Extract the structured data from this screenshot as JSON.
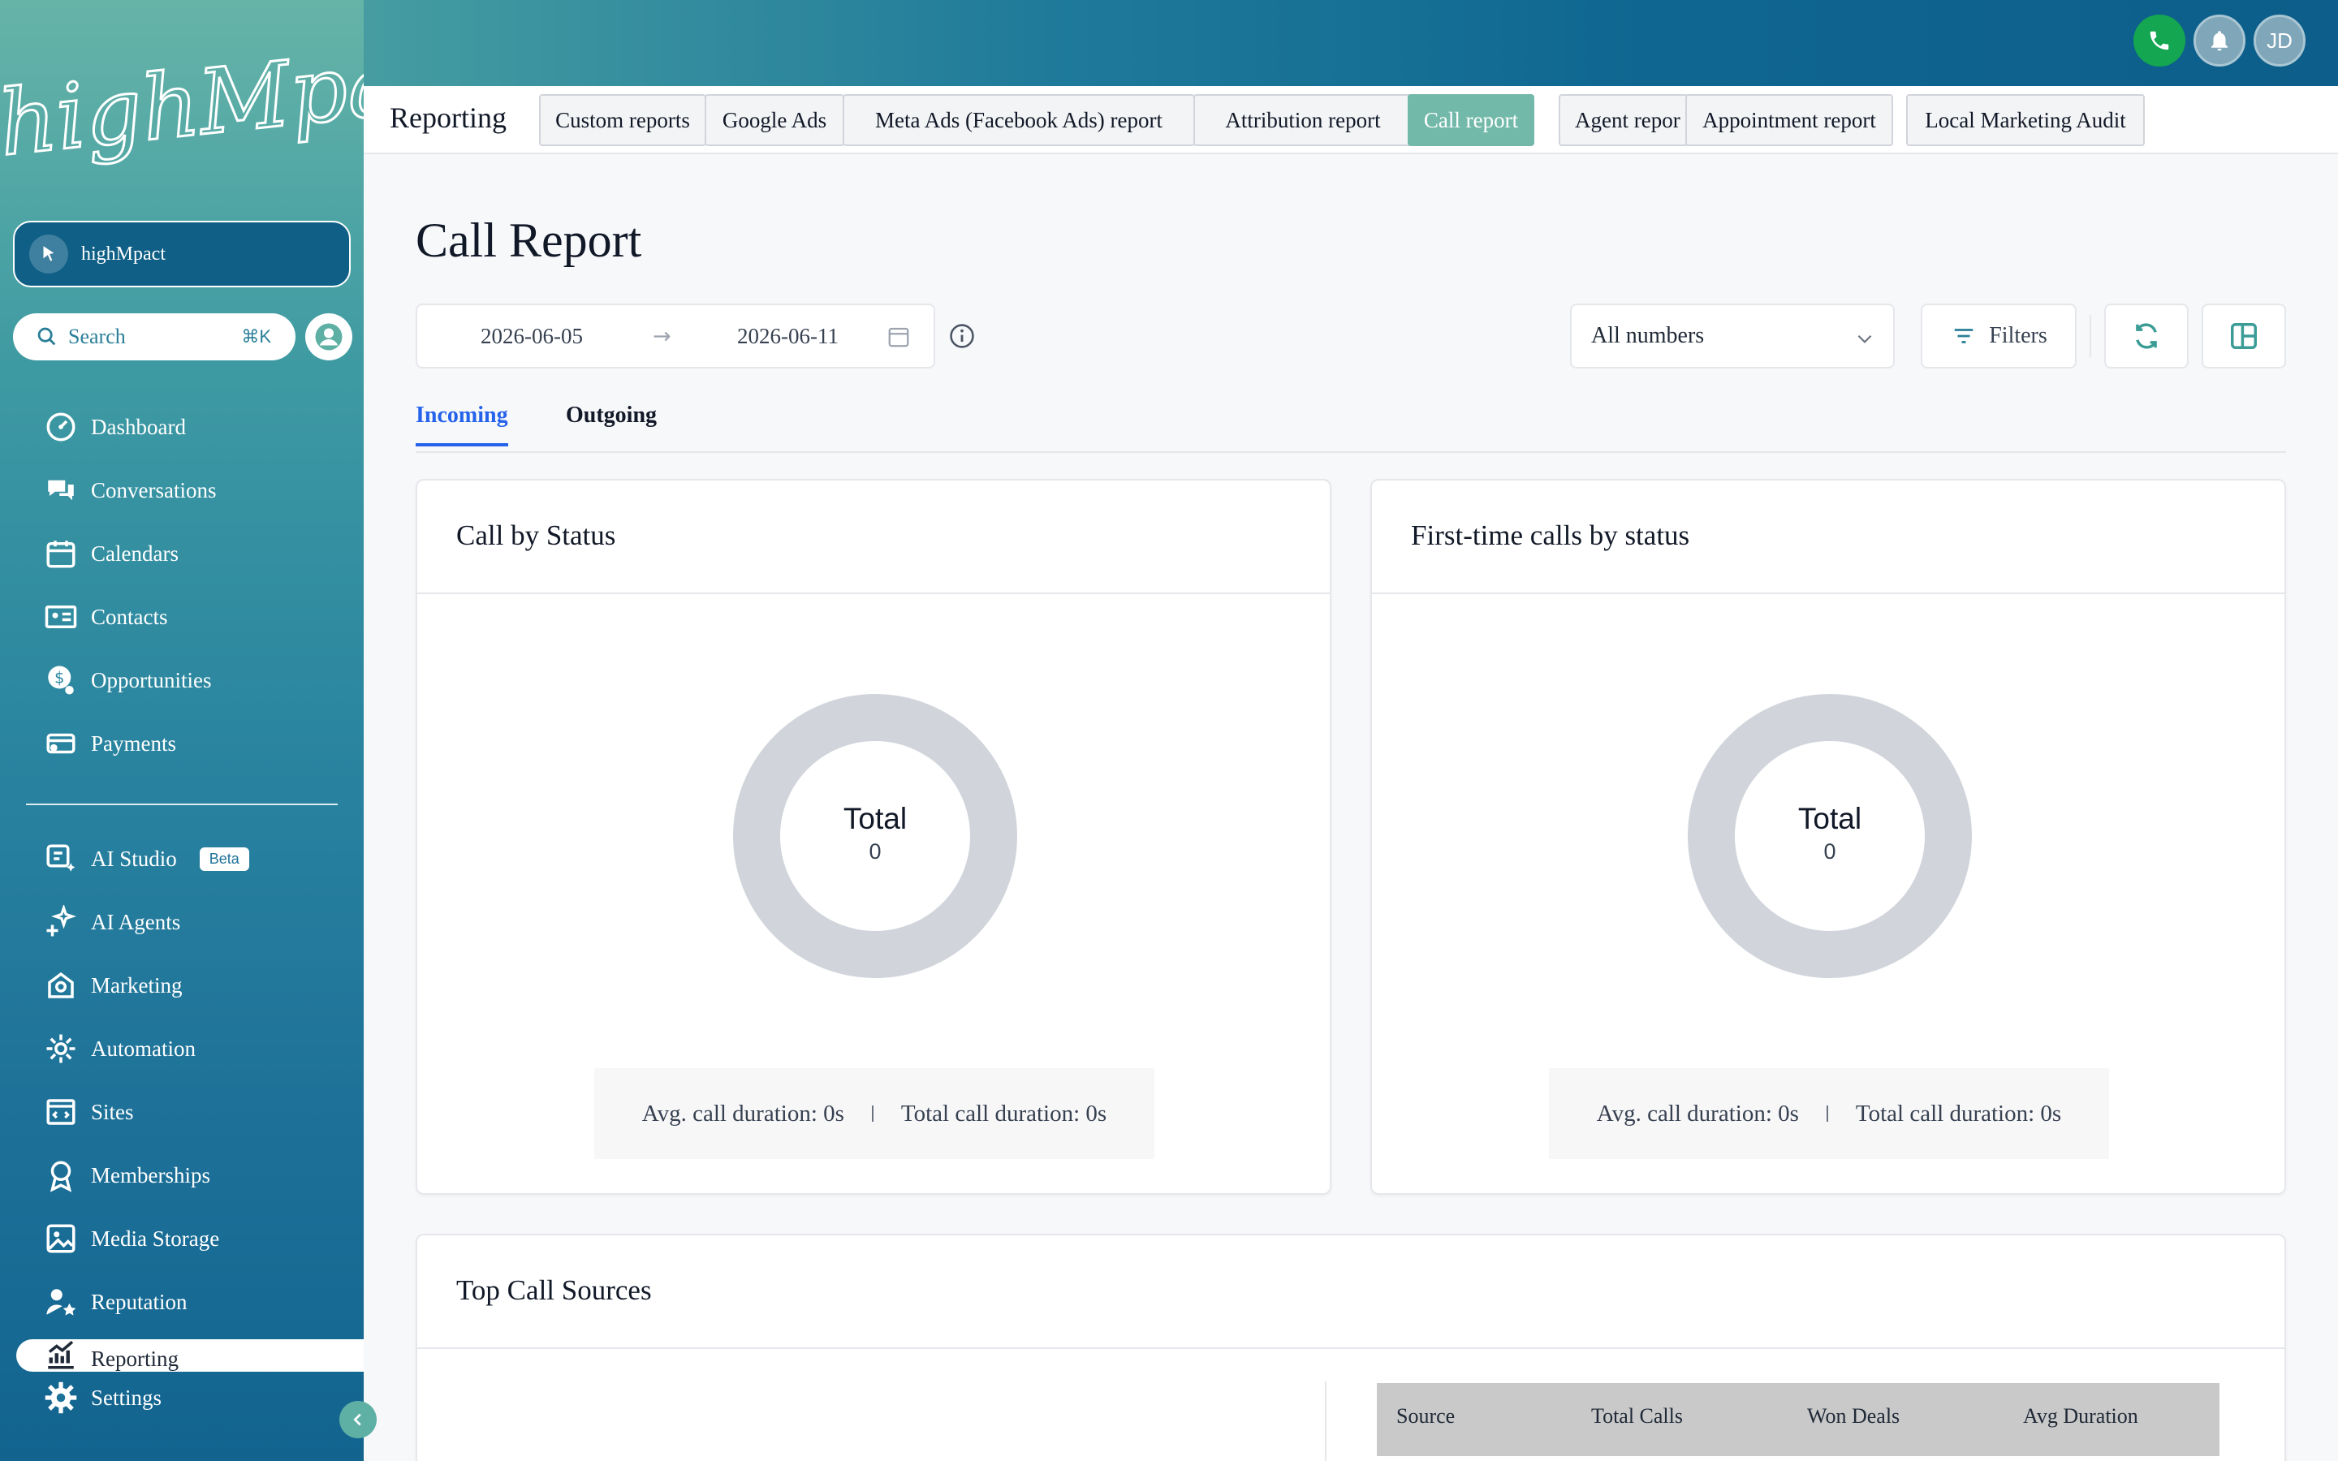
{
  "brand": {
    "logo_text": "highMpact"
  },
  "top_actions": {
    "avatar_initials": "JD"
  },
  "sidebar": {
    "account_name": "highMpact",
    "search": {
      "label": "Search",
      "shortcut": "⌘K"
    },
    "items": [
      {
        "label": "Dashboard",
        "icon": "dashboard-icon"
      },
      {
        "label": "Conversations",
        "icon": "chat-icon"
      },
      {
        "label": "Calendars",
        "icon": "calendar-icon"
      },
      {
        "label": "Contacts",
        "icon": "contacts-icon"
      },
      {
        "label": "Opportunities",
        "icon": "opportunities-icon"
      },
      {
        "label": "Payments",
        "icon": "payments-icon"
      }
    ],
    "items2": [
      {
        "label": "AI Studio",
        "icon": "ai-studio-icon",
        "badge": "Beta"
      },
      {
        "label": "AI Agents",
        "icon": "sparkle-icon"
      },
      {
        "label": "Marketing",
        "icon": "marketing-icon"
      },
      {
        "label": "Automation",
        "icon": "gear-icon"
      },
      {
        "label": "Sites",
        "icon": "sites-icon"
      },
      {
        "label": "Memberships",
        "icon": "badge-icon"
      },
      {
        "label": "Media Storage",
        "icon": "image-icon"
      },
      {
        "label": "Reputation",
        "icon": "reputation-icon"
      },
      {
        "label": "Reporting",
        "icon": "chart-icon"
      },
      {
        "label": "Settings",
        "icon": "settings-icon"
      }
    ]
  },
  "header": {
    "section_title": "Reporting",
    "tabs": [
      {
        "label": "Custom reports"
      },
      {
        "label": "Google Ads"
      },
      {
        "label": "Meta Ads (Facebook Ads) report"
      },
      {
        "label": "Attribution report"
      },
      {
        "label": "Call report",
        "active": true
      },
      {
        "label": "Agent repor"
      },
      {
        "label": "Appointment report"
      },
      {
        "label": "Local Marketing Audit"
      }
    ]
  },
  "main": {
    "title": "Call Report",
    "date_start": "2026-06-05",
    "date_arrow": "→",
    "date_end": "2026-06-11",
    "numbers_select": "All numbers",
    "filters_label": "Filters",
    "subtabs": [
      {
        "label": "Incoming",
        "active": true
      },
      {
        "label": "Outgoing"
      }
    ],
    "cards": [
      {
        "title": "Call by Status",
        "donut_label": "Total",
        "donut_value": "0",
        "avg_duration": "Avg. call duration: 0s",
        "total_duration": "Total call duration: 0s"
      },
      {
        "title": "First-time calls by status",
        "donut_label": "Total",
        "donut_value": "0",
        "avg_duration": "Avg. call duration: 0s",
        "total_duration": "Total call duration: 0s"
      }
    ],
    "top_sources": {
      "title": "Top Call Sources",
      "columns": [
        "Source",
        "Total Calls",
        "Won Deals",
        "Avg Duration"
      ]
    }
  },
  "colors": {
    "accent": "#73b9aa",
    "link_blue": "#2563eb",
    "phone_green": "#14a651",
    "donut_gray": "#d1d5db"
  }
}
